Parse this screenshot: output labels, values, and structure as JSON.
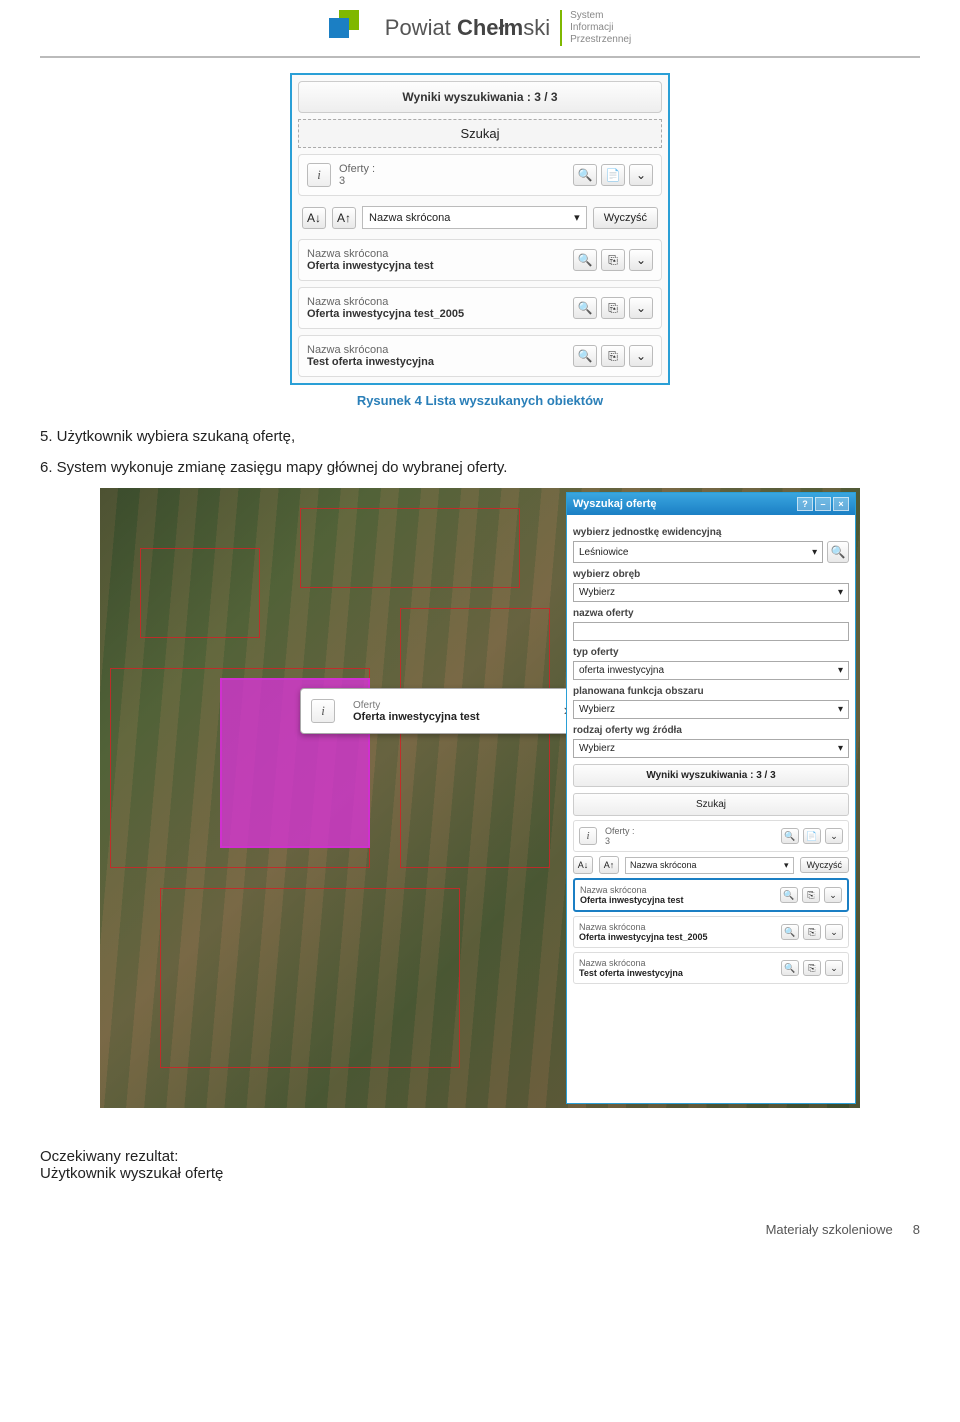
{
  "header": {
    "brand_powiat": "Powiat",
    "brand_chelmski": "Chełmski",
    "tagline1": "System",
    "tagline2": "Informacji",
    "tagline3": "Przestrzennej"
  },
  "figure1": {
    "results_bar": "Wyniki wyszukiwania : 3 / 3",
    "search_btn": "Szukaj",
    "offers_label": "Oferty :",
    "offers_count": "3",
    "sort_field": "Nazwa skrócona",
    "clear_btn": "Wyczyść",
    "items": [
      {
        "label": "Nazwa skrócona",
        "value": "Oferta inwestycyjna test"
      },
      {
        "label": "Nazwa skrócona",
        "value": "Oferta inwestycyjna test_2005"
      },
      {
        "label": "Nazwa skrócona",
        "value": "Test oferta inwestycyjna"
      }
    ],
    "caption": "Rysunek 4 Lista wyszukanych obiektów"
  },
  "body": {
    "step5": "5. Użytkownik wybiera szukaną ofertę,",
    "step6": "6. System wykonuje zmianę zasięgu mapy głównej do wybranej oferty."
  },
  "tooltip": {
    "label": "Oferty",
    "value": "Oferta inwestycyjna test"
  },
  "sidepanel": {
    "title": "Wyszukaj ofertę",
    "lbl_unit": "wybierz jednostkę ewidencyjną",
    "val_unit": "Leśniowice",
    "lbl_district": "wybierz obręb",
    "val_district": "Wybierz",
    "lbl_name": "nazwa oferty",
    "lbl_type": "typ oferty",
    "val_type": "oferta inwestycyjna",
    "lbl_func": "planowana funkcja obszaru",
    "val_func": "Wybierz",
    "lbl_src": "rodzaj oferty wg źródła",
    "val_src": "Wybierz",
    "results_bar": "Wyniki wyszukiwania : 3 / 3",
    "search_btn": "Szukaj",
    "offers_label": "Oferty :",
    "offers_count": "3",
    "sort_field": "Nazwa skrócona",
    "clear_btn": "Wyczyść",
    "items": [
      {
        "label": "Nazwa skrócona",
        "value": "Oferta inwestycyjna test"
      },
      {
        "label": "Nazwa skrócona",
        "value": "Oferta inwestycyjna test_2005"
      },
      {
        "label": "Nazwa skrócona",
        "value": "Test oferta inwestycyjna"
      }
    ]
  },
  "footer": {
    "line1": "Oczekiwany rezultat:",
    "line2": "Użytkownik wyszukał ofertę",
    "materials": "Materiały szkoleniowe",
    "page_num": "8"
  }
}
